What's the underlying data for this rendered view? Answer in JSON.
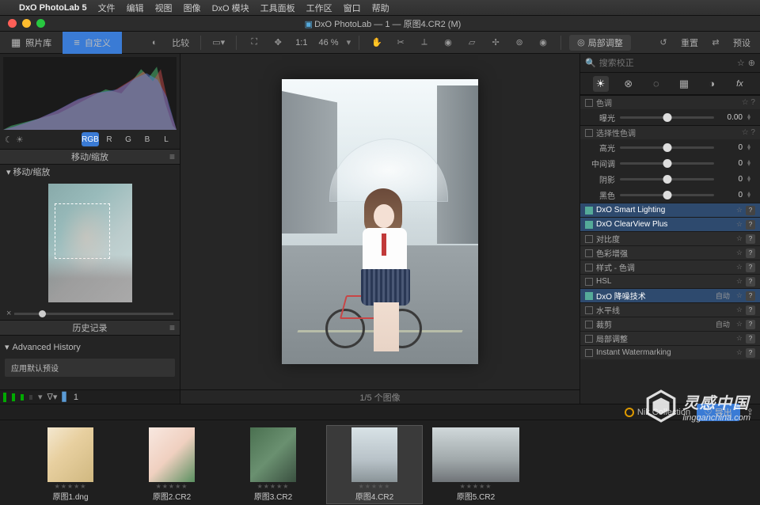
{
  "menubar": {
    "app": "DxO PhotoLab 5",
    "items": [
      "文件",
      "编辑",
      "视图",
      "图像",
      "DxO 模块",
      "工具面板",
      "工作区",
      "窗口",
      "帮助"
    ]
  },
  "title": "DxO PhotoLab — 1 — 原图4.CR2 (M)",
  "tabs": {
    "library": "照片库",
    "custom": "自定义"
  },
  "toolbar": {
    "compare": "比较",
    "ratio": "1:1",
    "zoom": "46 %",
    "localadj": "局部调整",
    "reset": "重置",
    "preset": "预设"
  },
  "left": {
    "channels": [
      "RGB",
      "R",
      "G",
      "B",
      "L"
    ],
    "move_zoom": "移动/缩放",
    "nav": "移动/缩放",
    "history": "历史记录",
    "adv": "Advanced History",
    "hist_item": "应用默认预设",
    "folder_count": "1"
  },
  "center": {
    "counter": "1/5 个图像"
  },
  "right": {
    "search_ph": "搜索校正",
    "group1": "色调",
    "exposure_lbl": "曝光",
    "exposure_val": "0.00",
    "sel_tone": "选择性色调",
    "sliders": [
      {
        "lbl": "高光",
        "val": "0"
      },
      {
        "lbl": "中间调",
        "val": "0"
      },
      {
        "lbl": "阴影",
        "val": "0"
      },
      {
        "lbl": "黑色",
        "val": "0"
      }
    ],
    "sections": [
      {
        "lbl": "DxO Smart Lighting",
        "hl": true
      },
      {
        "lbl": "DxO ClearView Plus",
        "hl": true
      },
      {
        "lbl": "对比度"
      },
      {
        "lbl": "色彩增强"
      },
      {
        "lbl": "样式 - 色调"
      },
      {
        "lbl": "HSL"
      },
      {
        "lbl": "DxO 降噪技术",
        "hl": true,
        "mode": "自动"
      },
      {
        "lbl": "水平线"
      },
      {
        "lbl": "裁剪",
        "mode": "自动"
      },
      {
        "lbl": "局部调整"
      },
      {
        "lbl": "Instant Watermarking"
      }
    ]
  },
  "filmstrip": {
    "nik": "Nik Collection",
    "export": "导出",
    "thumbs": [
      {
        "name": "原图1.dng",
        "cls": "t1"
      },
      {
        "name": "原图2.CR2",
        "cls": "t2"
      },
      {
        "name": "原图3.CR2",
        "cls": "t3"
      },
      {
        "name": "原图4.CR2",
        "cls": "t4",
        "sel": true
      },
      {
        "name": "原图5.CR2",
        "cls": "wide",
        "wide": true
      }
    ]
  },
  "watermark": {
    "cn": "灵感中国",
    "en": "lingganchina.com"
  }
}
